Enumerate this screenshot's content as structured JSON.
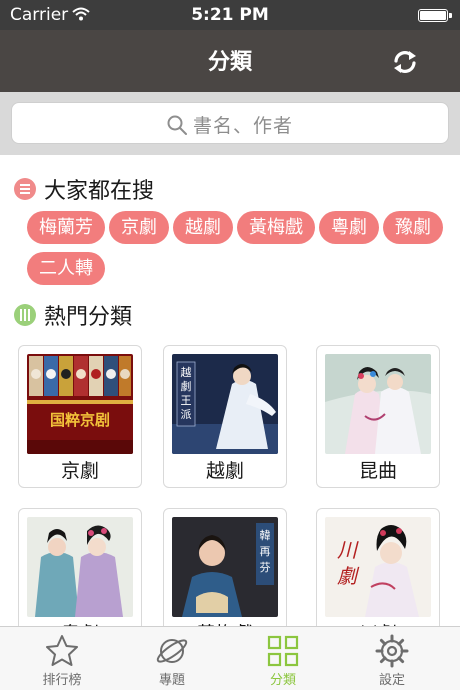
{
  "status": {
    "carrier": "Carrier",
    "time": "5:21 PM"
  },
  "nav": {
    "title": "分類"
  },
  "search": {
    "placeholder": "書名、作者"
  },
  "hot_search": {
    "title": "大家都在搜",
    "tags": [
      "梅蘭芳",
      "京劇",
      "越劇",
      "黃梅戲",
      "粵劇",
      "豫劇",
      "二人轉"
    ]
  },
  "categories": {
    "title": "熱門分類",
    "items": [
      {
        "label": "京劇",
        "poster_text": "国粹京剧"
      },
      {
        "label": "越劇",
        "poster_text": "越劇王派"
      },
      {
        "label": "昆曲"
      },
      {
        "label": "粵劇"
      },
      {
        "label": "黃梅戲",
        "poster_text": "韓再芬"
      },
      {
        "label": "川劇",
        "poster_text": "川劇"
      }
    ]
  },
  "tabs": [
    {
      "label": "排行榜",
      "icon": "star-icon"
    },
    {
      "label": "專題",
      "icon": "planet-icon"
    },
    {
      "label": "分類",
      "icon": "grid-icon",
      "active": true
    },
    {
      "label": "設定",
      "icon": "gear-icon"
    }
  ],
  "colors": {
    "accent_green": "#8cc63f",
    "tag_red": "#f27d7d",
    "nav_bg": "#4a4644"
  }
}
